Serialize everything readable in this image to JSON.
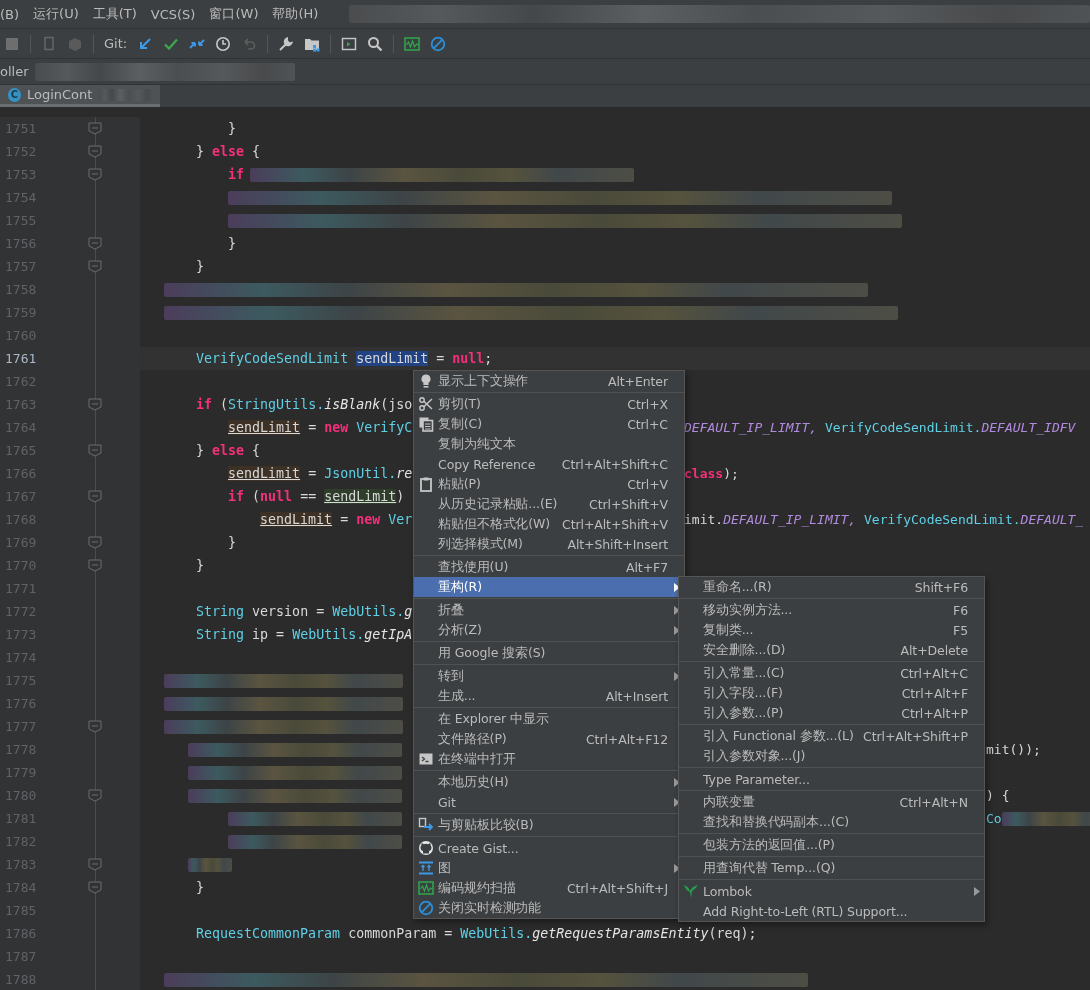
{
  "menu_bar": {
    "items": [
      "(B)",
      "运行(U)",
      "工具(T)",
      "VCS(S)",
      "窗口(W)",
      "帮助(H)"
    ]
  },
  "toolbar": {
    "git_label": "Git:"
  },
  "nav_bar": {
    "crumb": "oller"
  },
  "editor_tab": {
    "icon_text": "C",
    "label": "LoginCont",
    "selected": true
  },
  "editor": {
    "lines": [
      {
        "number": "1751",
        "fold": true,
        "current": false,
        "redacted": false,
        "tokens": [
          {
            "text": "        }",
            "kind": "plain"
          }
        ]
      },
      {
        "number": "1752",
        "fold": true,
        "current": false,
        "redacted": false,
        "tokens": [
          {
            "text": "    } ",
            "kind": "plain"
          },
          {
            "text": "else",
            "kind": "kw"
          },
          {
            "text": " {",
            "kind": "plain"
          }
        ]
      },
      {
        "number": "1753",
        "fold": true,
        "current": false,
        "redacted": true,
        "tokens": [
          {
            "text": "        if",
            "kind": "kw"
          }
        ]
      },
      {
        "number": "1754",
        "fold": false,
        "current": false,
        "redacted": true
      },
      {
        "number": "1755",
        "fold": false,
        "current": false,
        "redacted": true
      },
      {
        "number": "1756",
        "fold": true,
        "current": false,
        "redacted": false,
        "tokens": [
          {
            "text": "        }",
            "kind": "plain"
          }
        ]
      },
      {
        "number": "1757",
        "fold": true,
        "current": false,
        "redacted": false,
        "tokens": [
          {
            "text": "    }",
            "kind": "plain"
          }
        ]
      },
      {
        "number": "1758",
        "fold": false,
        "current": false,
        "redacted": true
      },
      {
        "number": "1759",
        "fold": false,
        "current": false,
        "redacted": true
      },
      {
        "number": "1760",
        "fold": false,
        "current": false,
        "redacted": false
      },
      {
        "number": "1761",
        "fold": false,
        "current": true,
        "redacted": false,
        "tokens": [
          {
            "text": "    VerifyCodeSendLimit ",
            "kind": "type"
          },
          {
            "text": "sendLimit",
            "kind": "selected"
          },
          {
            "text": " = ",
            "kind": "plain"
          },
          {
            "text": "null",
            "kind": "kw"
          },
          {
            "text": ";",
            "kind": "plain"
          }
        ]
      },
      {
        "number": "1762",
        "fold": false,
        "current": false,
        "redacted": false
      },
      {
        "number": "1763",
        "fold": true,
        "current": false,
        "redacted": false,
        "tokens": [
          {
            "text": "    if",
            "kind": "kw"
          },
          {
            "text": " (",
            "kind": "plain"
          },
          {
            "text": "StringUtils.",
            "kind": "type"
          },
          {
            "text": "isBlank",
            "kind": "italic"
          },
          {
            "text": "(jso",
            "kind": "plain"
          }
        ]
      },
      {
        "number": "1764",
        "fold": false,
        "current": false,
        "redacted": false,
        "tokens": [
          {
            "text": "        sendLimit",
            "kind": "write"
          },
          {
            "text": " = ",
            "kind": "plain"
          },
          {
            "text": "new",
            "kind": "kw"
          },
          {
            "text": " VerifyC",
            "kind": "type"
          }
        ],
        "tail": {
          "kind": "menu",
          "redacted": false,
          "tokens": [
            {
              "text": "DEFAULT_IP_LIMIT, ",
              "kind": "const"
            },
            {
              "text": "VerifyCodeSendLimit.",
              "kind": "type"
            },
            {
              "text": "DEFAULT_IDFV",
              "kind": "const"
            }
          ]
        }
      },
      {
        "number": "1765",
        "fold": true,
        "current": false,
        "redacted": false,
        "tokens": [
          {
            "text": "    } ",
            "kind": "plain"
          },
          {
            "text": "else",
            "kind": "kw"
          },
          {
            "text": " {",
            "kind": "plain"
          }
        ]
      },
      {
        "number": "1766",
        "fold": false,
        "current": false,
        "redacted": false,
        "tokens": [
          {
            "text": "        sendLimit",
            "kind": "write"
          },
          {
            "text": " = ",
            "kind": "plain"
          },
          {
            "text": "JsonUtil.",
            "kind": "type"
          },
          {
            "text": "re",
            "kind": "italic"
          }
        ],
        "tail": {
          "kind": "menu",
          "redacted": false,
          "tokens": [
            {
              "text": "class",
              "kind": "kw"
            },
            {
              "text": ");",
              "kind": "plain"
            }
          ]
        }
      },
      {
        "number": "1767",
        "fold": true,
        "current": false,
        "redacted": false,
        "tokens": [
          {
            "text": "        if",
            "kind": "kw"
          },
          {
            "text": " (",
            "kind": "plain"
          },
          {
            "text": "null",
            "kind": "kw"
          },
          {
            "text": " == ",
            "kind": "plain"
          },
          {
            "text": "sendLimit",
            "kind": "read"
          },
          {
            "text": ")",
            "kind": "plain"
          }
        ]
      },
      {
        "number": "1768",
        "fold": false,
        "current": false,
        "redacted": false,
        "tokens": [
          {
            "text": "            sendLimit",
            "kind": "write"
          },
          {
            "text": " = ",
            "kind": "plain"
          },
          {
            "text": "new",
            "kind": "kw"
          },
          {
            "text": " Ver",
            "kind": "type"
          }
        ],
        "tail": {
          "kind": "menu",
          "redacted": false,
          "tokens": [
            {
              "text": "imit.",
              "kind": "plain"
            },
            {
              "text": "DEFAULT_IP_LIMIT, ",
              "kind": "const"
            },
            {
              "text": "VerifyCodeSendLimit.",
              "kind": "type"
            },
            {
              "text": "DEFAULT_",
              "kind": "const"
            }
          ]
        }
      },
      {
        "number": "1769",
        "fold": true,
        "current": false,
        "redacted": false,
        "tokens": [
          {
            "text": "        }",
            "kind": "plain"
          }
        ]
      },
      {
        "number": "1770",
        "fold": true,
        "current": false,
        "redacted": false,
        "tokens": [
          {
            "text": "    }",
            "kind": "plain"
          }
        ]
      },
      {
        "number": "1771",
        "fold": false,
        "current": false,
        "redacted": false
      },
      {
        "number": "1772",
        "fold": false,
        "current": false,
        "redacted": false,
        "tokens": [
          {
            "text": "    String",
            "kind": "type"
          },
          {
            "text": " version = ",
            "kind": "plain"
          },
          {
            "text": "WebUtils.",
            "kind": "type"
          },
          {
            "text": "g",
            "kind": "italic"
          }
        ]
      },
      {
        "number": "1773",
        "fold": false,
        "current": false,
        "redacted": false,
        "tokens": [
          {
            "text": "    String",
            "kind": "type"
          },
          {
            "text": " ip = ",
            "kind": "plain"
          },
          {
            "text": "WebUtils.",
            "kind": "type"
          },
          {
            "text": "getIpA",
            "kind": "italic"
          }
        ]
      },
      {
        "number": "1774",
        "fold": false,
        "current": false,
        "redacted": false
      },
      {
        "number": "1775",
        "fold": false,
        "current": false,
        "redacted": true
      },
      {
        "number": "1776",
        "fold": false,
        "current": false,
        "redacted": true
      },
      {
        "number": "1777",
        "fold": true,
        "current": false,
        "redacted": true
      },
      {
        "number": "1778",
        "fold": false,
        "current": false,
        "redacted": true,
        "tail": {
          "kind": "submenu",
          "redacted": false,
          "tokens": [
            {
              "text": "mit());",
              "kind": "plain"
            }
          ]
        }
      },
      {
        "number": "1779",
        "fold": false,
        "current": false,
        "redacted": true
      },
      {
        "number": "1780",
        "fold": true,
        "current": false,
        "redacted": true,
        "tail": {
          "kind": "submenu",
          "redacted": false,
          "tokens": [
            {
              "text": ") {",
              "kind": "plain"
            }
          ]
        }
      },
      {
        "number": "1781",
        "fold": false,
        "current": false,
        "redacted": true,
        "tail": {
          "kind": "submenu",
          "redacted": true,
          "tokens": [
            {
              "text": "Co",
              "kind": "type"
            }
          ]
        }
      },
      {
        "number": "1782",
        "fold": false,
        "current": false,
        "redacted": true
      },
      {
        "number": "1783",
        "fold": true,
        "current": false,
        "redacted": true
      },
      {
        "number": "1784",
        "fold": true,
        "current": false,
        "redacted": false,
        "tokens": [
          {
            "text": "    }",
            "kind": "plain"
          }
        ]
      },
      {
        "number": "1785",
        "fold": false,
        "current": false,
        "redacted": false
      },
      {
        "number": "1786",
        "fold": false,
        "current": false,
        "redacted": false,
        "tokens": [
          {
            "text": "    RequestCommonParam",
            "kind": "type"
          },
          {
            "text": " commonParam = ",
            "kind": "plain"
          },
          {
            "text": "WebUtils.",
            "kind": "type"
          },
          {
            "text": "getRequestParamsEntity",
            "kind": "italic"
          },
          {
            "text": "(req);",
            "kind": "plain"
          }
        ]
      },
      {
        "number": "1787",
        "fold": false,
        "current": false,
        "redacted": false
      },
      {
        "number": "1788",
        "fold": false,
        "current": false,
        "redacted": true
      }
    ]
  },
  "context_menu": {
    "groups": [
      {
        "items": [
          {
            "label": "显示上下文操作",
            "shortcut": "Alt+Enter",
            "submenu": false,
            "selected": false
          }
        ]
      },
      {
        "items": [
          {
            "label": "剪切(T)",
            "shortcut": "Ctrl+X",
            "submenu": false,
            "selected": false
          },
          {
            "label": "复制(C)",
            "shortcut": "Ctrl+C",
            "submenu": false,
            "selected": false
          },
          {
            "label": "复制为纯文本",
            "submenu": false,
            "selected": false
          },
          {
            "label": "Copy Reference",
            "shortcut": "Ctrl+Alt+Shift+C",
            "submenu": false,
            "selected": false
          },
          {
            "label": "粘贴(P)",
            "shortcut": "Ctrl+V",
            "submenu": false,
            "selected": false
          },
          {
            "label": "从历史记录粘贴...(E)",
            "shortcut": "Ctrl+Shift+V",
            "submenu": false,
            "selected": false
          },
          {
            "label": "粘贴但不格式化(W)",
            "shortcut": "Ctrl+Alt+Shift+V",
            "submenu": false,
            "selected": false
          },
          {
            "label": "列选择模式(M)",
            "shortcut": "Alt+Shift+Insert",
            "submenu": false,
            "selected": false
          }
        ]
      },
      {
        "items": [
          {
            "label": "查找使用(U)",
            "shortcut": "Alt+F7",
            "submenu": false,
            "selected": false
          },
          {
            "label": "重构(R)",
            "submenu": true,
            "selected": true
          }
        ]
      },
      {
        "items": [
          {
            "label": "折叠",
            "submenu": true,
            "selected": false
          },
          {
            "label": "分析(Z)",
            "submenu": true,
            "selected": false
          }
        ]
      },
      {
        "items": [
          {
            "label": "用 Google 搜索(S)",
            "submenu": false,
            "selected": false
          }
        ]
      },
      {
        "items": [
          {
            "label": "转到",
            "submenu": true,
            "selected": false
          },
          {
            "label": "生成...",
            "shortcut": "Alt+Insert",
            "submenu": false,
            "selected": false
          }
        ]
      },
      {
        "items": [
          {
            "label": "在 Explorer 中显示",
            "submenu": false,
            "selected": false
          },
          {
            "label": "文件路径(P)",
            "shortcut": "Ctrl+Alt+F12",
            "submenu": false,
            "selected": false
          },
          {
            "label": "在终端中打开",
            "submenu": false,
            "selected": false
          }
        ]
      },
      {
        "items": [
          {
            "label": "本地历史(H)",
            "submenu": true,
            "selected": false
          },
          {
            "label": "Git",
            "submenu": true,
            "selected": false
          }
        ]
      },
      {
        "items": [
          {
            "label": "与剪贴板比较(B)",
            "submenu": false,
            "selected": false
          }
        ]
      },
      {
        "items": [
          {
            "label": "Create Gist...",
            "submenu": false,
            "selected": false
          },
          {
            "label": "图",
            "submenu": true,
            "selected": false
          },
          {
            "label": "编码规约扫描",
            "shortcut": "Ctrl+Alt+Shift+J",
            "submenu": false,
            "selected": false
          },
          {
            "label": "关闭实时检测功能",
            "submenu": false,
            "selected": false
          }
        ]
      }
    ]
  },
  "refactor_submenu": {
    "groups": [
      {
        "items": [
          {
            "label": "重命名...(R)",
            "shortcut": "Shift+F6",
            "submenu": false,
            "selected": false
          }
        ]
      },
      {
        "items": [
          {
            "label": "移动实例方法...",
            "shortcut": "F6",
            "submenu": false,
            "selected": false
          },
          {
            "label": "复制类...",
            "shortcut": "F5",
            "submenu": false,
            "selected": false
          },
          {
            "label": "安全删除...(D)",
            "shortcut": "Alt+Delete",
            "submenu": false,
            "selected": false
          }
        ]
      },
      {
        "items": [
          {
            "label": "引入常量...(C)",
            "shortcut": "Ctrl+Alt+C",
            "submenu": false,
            "selected": false
          },
          {
            "label": "引入字段...(F)",
            "shortcut": "Ctrl+Alt+F",
            "submenu": false,
            "selected": false
          },
          {
            "label": "引入参数...(P)",
            "shortcut": "Ctrl+Alt+P",
            "submenu": false,
            "selected": false
          }
        ]
      },
      {
        "items": [
          {
            "label": "引入 Functional 参数...(L)",
            "shortcut": "Ctrl+Alt+Shift+P",
            "submenu": false,
            "selected": false
          },
          {
            "label": "引入参数对象...(J)",
            "submenu": false,
            "selected": false
          }
        ]
      },
      {
        "items": [
          {
            "label": "Type Parameter...",
            "submenu": false,
            "selected": false
          }
        ]
      },
      {
        "items": [
          {
            "label": "内联变量",
            "shortcut": "Ctrl+Alt+N",
            "submenu": false,
            "selected": false
          },
          {
            "label": "查找和替换代码副本...(C)",
            "submenu": false,
            "selected": false
          }
        ]
      },
      {
        "items": [
          {
            "label": "包装方法的返回值...(P)",
            "submenu": false,
            "selected": false
          }
        ]
      },
      {
        "items": [
          {
            "label": "用查询代替 Temp...(Q)",
            "submenu": false,
            "selected": false
          }
        ]
      },
      {
        "items": [
          {
            "label": "Lombok",
            "submenu": true,
            "selected": false
          },
          {
            "label": "Add Right-to-Left (RTL) Support...",
            "submenu": false,
            "selected": false
          }
        ]
      }
    ]
  }
}
